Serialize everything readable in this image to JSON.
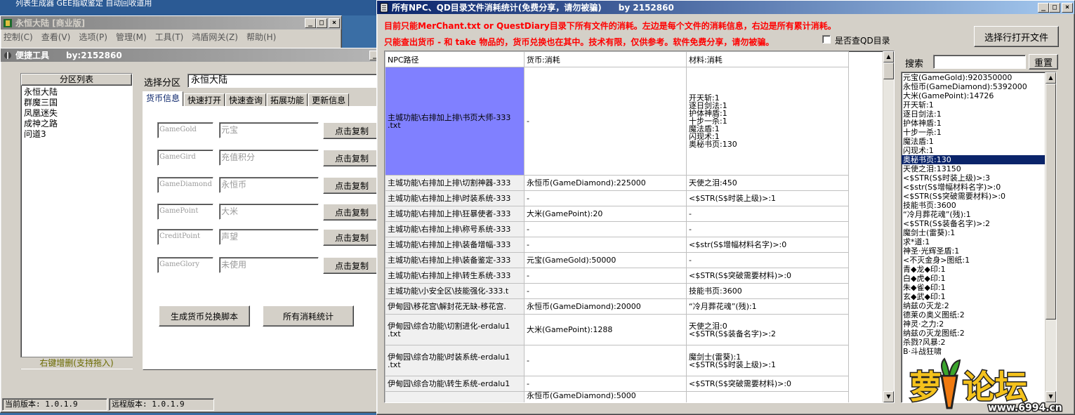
{
  "bg_strip": {
    "text": "列表生成器    GEE指取鉴定  自动回收道用"
  },
  "main_window": {
    "title": "永恒大陆 [商业版]",
    "menu": [
      "控制(C)",
      "查看(V)",
      "选项(P)",
      "管理(M)",
      "工具(T)",
      "鸿盾网关(Z)",
      "帮助(H)"
    ]
  },
  "tool_window": {
    "title": "便捷工具",
    "by": "by:2152860",
    "zone_header": "分区列表",
    "zones": [
      "永恒大陆",
      "群魔三国",
      "凤凰迷失",
      "成神之路",
      "问道3"
    ],
    "zone_footer": "右键增删(支持拖入)",
    "select_zone_label": "选择分区",
    "select_zone_value": "永恒大陆",
    "tabs": [
      "货币信息",
      "快速打开",
      "快速查询",
      "拓展功能",
      "更新信息"
    ],
    "currencies": [
      {
        "code": "GameGold",
        "name": "元宝",
        "button": "点击复制"
      },
      {
        "code": "GameGird",
        "name": "充值积分",
        "button": "点击复制"
      },
      {
        "code": "GameDiamond",
        "name": "永恒币",
        "button": "点击复制"
      },
      {
        "code": "GamePoint",
        "name": "大米",
        "button": "点击复制"
      },
      {
        "code": "CreditPoint",
        "name": "声望",
        "button": "点击复制"
      },
      {
        "code": "GameGlory",
        "name": "未使用",
        "button": "点击复制"
      }
    ],
    "gen_script_button": "生成货币兑换脚本",
    "all_stats_button": "所有消耗统计"
  },
  "status_bar": {
    "current": "当前版本: 1.0.1.9",
    "remote": "远程版本: 1.0.1.9"
  },
  "stats_window": {
    "title": "所有NPC、QD目录文件消耗统计(免费分享，请勿被骗)",
    "by": "by 2152860",
    "notice1": "目前只能MerChant.txt or QuestDiary目录下所有文件的消耗。左边是每个文件的消耗信息，右边是所有累计消耗。",
    "notice2": "只能查出货币 - 和 take 物品的，货币兑换也在其中。技术有限，仅供参考。软件免费分享，请勿被骗。",
    "checkbox_label": "是否查QD目录",
    "open_file_button": "选择行打开文件",
    "search_label": "搜索",
    "search_value": "",
    "reset_button": "重置",
    "columns": [
      "NPC路径",
      "货币:消耗",
      "材料:消耗"
    ],
    "rows": [
      {
        "path": "主城功能\\右排加上排\\书页大师-333\n.txt",
        "currency": "-",
        "material": "开天斩:1\n逐日剑法:1\n护体神盾:1\n十步一杀:1\n魔法盾:1\n闪现术:1\n奥秘书页:130"
      },
      {
        "path": "主城功能\\右排加上排\\切割神器-333",
        "currency": "永恒币(GameDiamond):225000",
        "material": "天使之泪:450"
      },
      {
        "path": "主城功能\\右排加上排\\时装系统-333",
        "currency": "-",
        "material": "<$STR(S$时装上级)>:1"
      },
      {
        "path": "主城功能\\右排加上排\\狂暴使者-333",
        "currency": "大米(GamePoint):20",
        "material": "-"
      },
      {
        "path": "主城功能\\右排加上排\\称号系统-333",
        "currency": "-",
        "material": "-"
      },
      {
        "path": "主城功能\\右排加上排\\装备增幅-333",
        "currency": "-",
        "material": "<$str(S$增幅材料名字)>:0"
      },
      {
        "path": "主城功能\\右排加上排\\装备鉴定-333",
        "currency": "元宝(GameGold):50000",
        "material": "-"
      },
      {
        "path": "主城功能\\右排加上排\\转生系统-333",
        "currency": "-",
        "material": "<$STR(S$突破需要材料)>:0"
      },
      {
        "path": "主城功能\\小安全区\\技能强化-333.t",
        "currency": "-",
        "material": "技能书页:3600"
      },
      {
        "path": "伊甸园\\移花宫\\解封花无缺-移花宫.",
        "currency": "永恒币(GameDiamond):20000",
        "material": "“冷月葬花魂”(残):1"
      },
      {
        "path": "伊甸园\\综合功能\\切割进化-erdalu1\n.txt",
        "currency": "大米(GamePoint):1288",
        "material": "天使之泪:0\n<$STR(S$装备名字)>:2"
      },
      {
        "path": "伊甸园\\综合功能\\时装系统-erdalu1\n.txt",
        "currency": "-",
        "material": "魔剑士(雷葵):1\n<$STR(S$时装上级)>:1"
      },
      {
        "path": "伊甸园\\综合功能\\转生系统-erdalu1",
        "currency": "-",
        "material": "<$STR(S$突破需要材料)>:0"
      },
      {
        "path": "",
        "currency": "永恒币(GameDiamond):5000",
        "material": ""
      }
    ],
    "totals": [
      "元宝(GameGold):920350000",
      "永恒币(GameDiamond):5392000",
      "大米(GamePoint):14726",
      "开天斩:1",
      "逐日剑法:1",
      "护体神盾:1",
      "十步一杀:1",
      "魔法盾:1",
      "闪现术:1",
      "奥秘书页:130",
      "天使之泪:13150",
      "<$STR(S$时装上级)>:3",
      "<$str(S$增幅材料名字)>:0",
      "<$STR(S$突破需要材料)>:0",
      "技能书页:3600",
      "“冷月葬花魂”(残):1",
      "<$STR(S$装备名字)>:2",
      "魔剑士(雷葵):1",
      "求*道:1",
      "神圣·光辉圣盾:1",
      "<不灭金身>图纸:1",
      "青◆龙◆印:1",
      "白◆虎◆印:1",
      "朱◆雀◆印:1",
      "玄◆武◆印:1",
      "纳兹の灭龙:2",
      "德莱の奥义图纸:2",
      "神灵·之力:2",
      "纳兹の灭龙图纸:2",
      "杀戮?风暴:2",
      "B·斗战狂啸"
    ],
    "selected_total_index": 9
  },
  "watermark": {
    "brand": "萝卜论坛",
    "url": "www.6994.cn"
  }
}
